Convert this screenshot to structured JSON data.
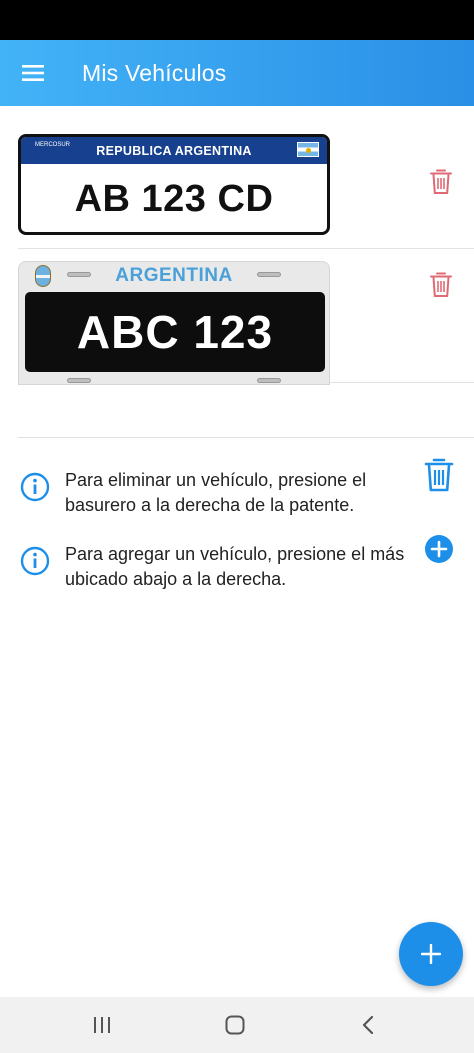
{
  "app_bar": {
    "title": "Mis Vehículos",
    "menu_icon": "hamburger-menu-icon",
    "background": "#2a8fe6"
  },
  "vehicles": [
    {
      "plate_style": "mercosur",
      "header": "REPUBLICA ARGENTINA",
      "emblem": "MERCOSUR",
      "plate_number": "AB 123 CD",
      "delete_icon": "trash-icon"
    },
    {
      "plate_style": "old-argentina",
      "header": "ARGENTINA",
      "plate_number": "ABC 123",
      "delete_icon": "trash-icon"
    }
  ],
  "hints": [
    {
      "text": "Para eliminar un vehículo, presione el basurero a la derecha de la patente.",
      "icon": "info-icon",
      "side_icon": "trash-icon"
    },
    {
      "text": "Para agregar un vehículo, presione el más ubicado abajo a la derecha.",
      "icon": "info-icon",
      "side_icon": "add-circle-icon"
    }
  ],
  "fab": {
    "icon": "plus-icon",
    "color": "#1e8fe8"
  },
  "nav_bar": {
    "items": [
      "recent-apps-icon",
      "home-icon",
      "back-icon"
    ]
  },
  "colors": {
    "accent": "#1e8fe8",
    "delete_red": "#e06a74"
  }
}
